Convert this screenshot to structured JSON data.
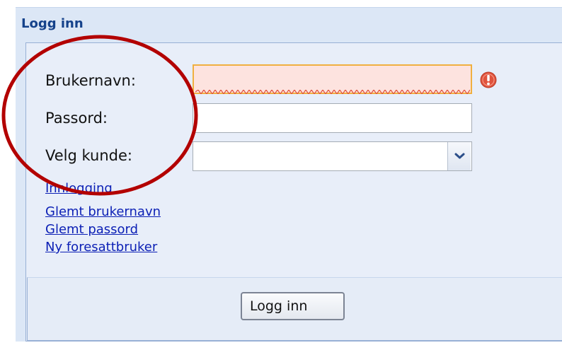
{
  "panel": {
    "title": "Logg inn"
  },
  "form": {
    "username_label": "Brukernavn:",
    "username_value": "",
    "password_label": "Passord:",
    "password_value": "",
    "customer_label": "Velg kunde:",
    "customer_selected": ""
  },
  "links": {
    "login": "Innlogging",
    "forgot_username": "Glemt brukernavn",
    "forgot_password": "Glemt passord",
    "new_guardian_user": "Ny foresattbruker"
  },
  "buttons": {
    "login": "Logg inn"
  },
  "icons": {
    "error": "error-exclamation-icon",
    "dropdown": "chevron-down-icon"
  },
  "colors": {
    "title": "#15428b",
    "link": "#0b1fb5",
    "error": "#e0533d",
    "highlight_ellipse": "#b30000",
    "invalid_field_bg": "#fde3df",
    "invalid_field_border": "#f0b040"
  }
}
